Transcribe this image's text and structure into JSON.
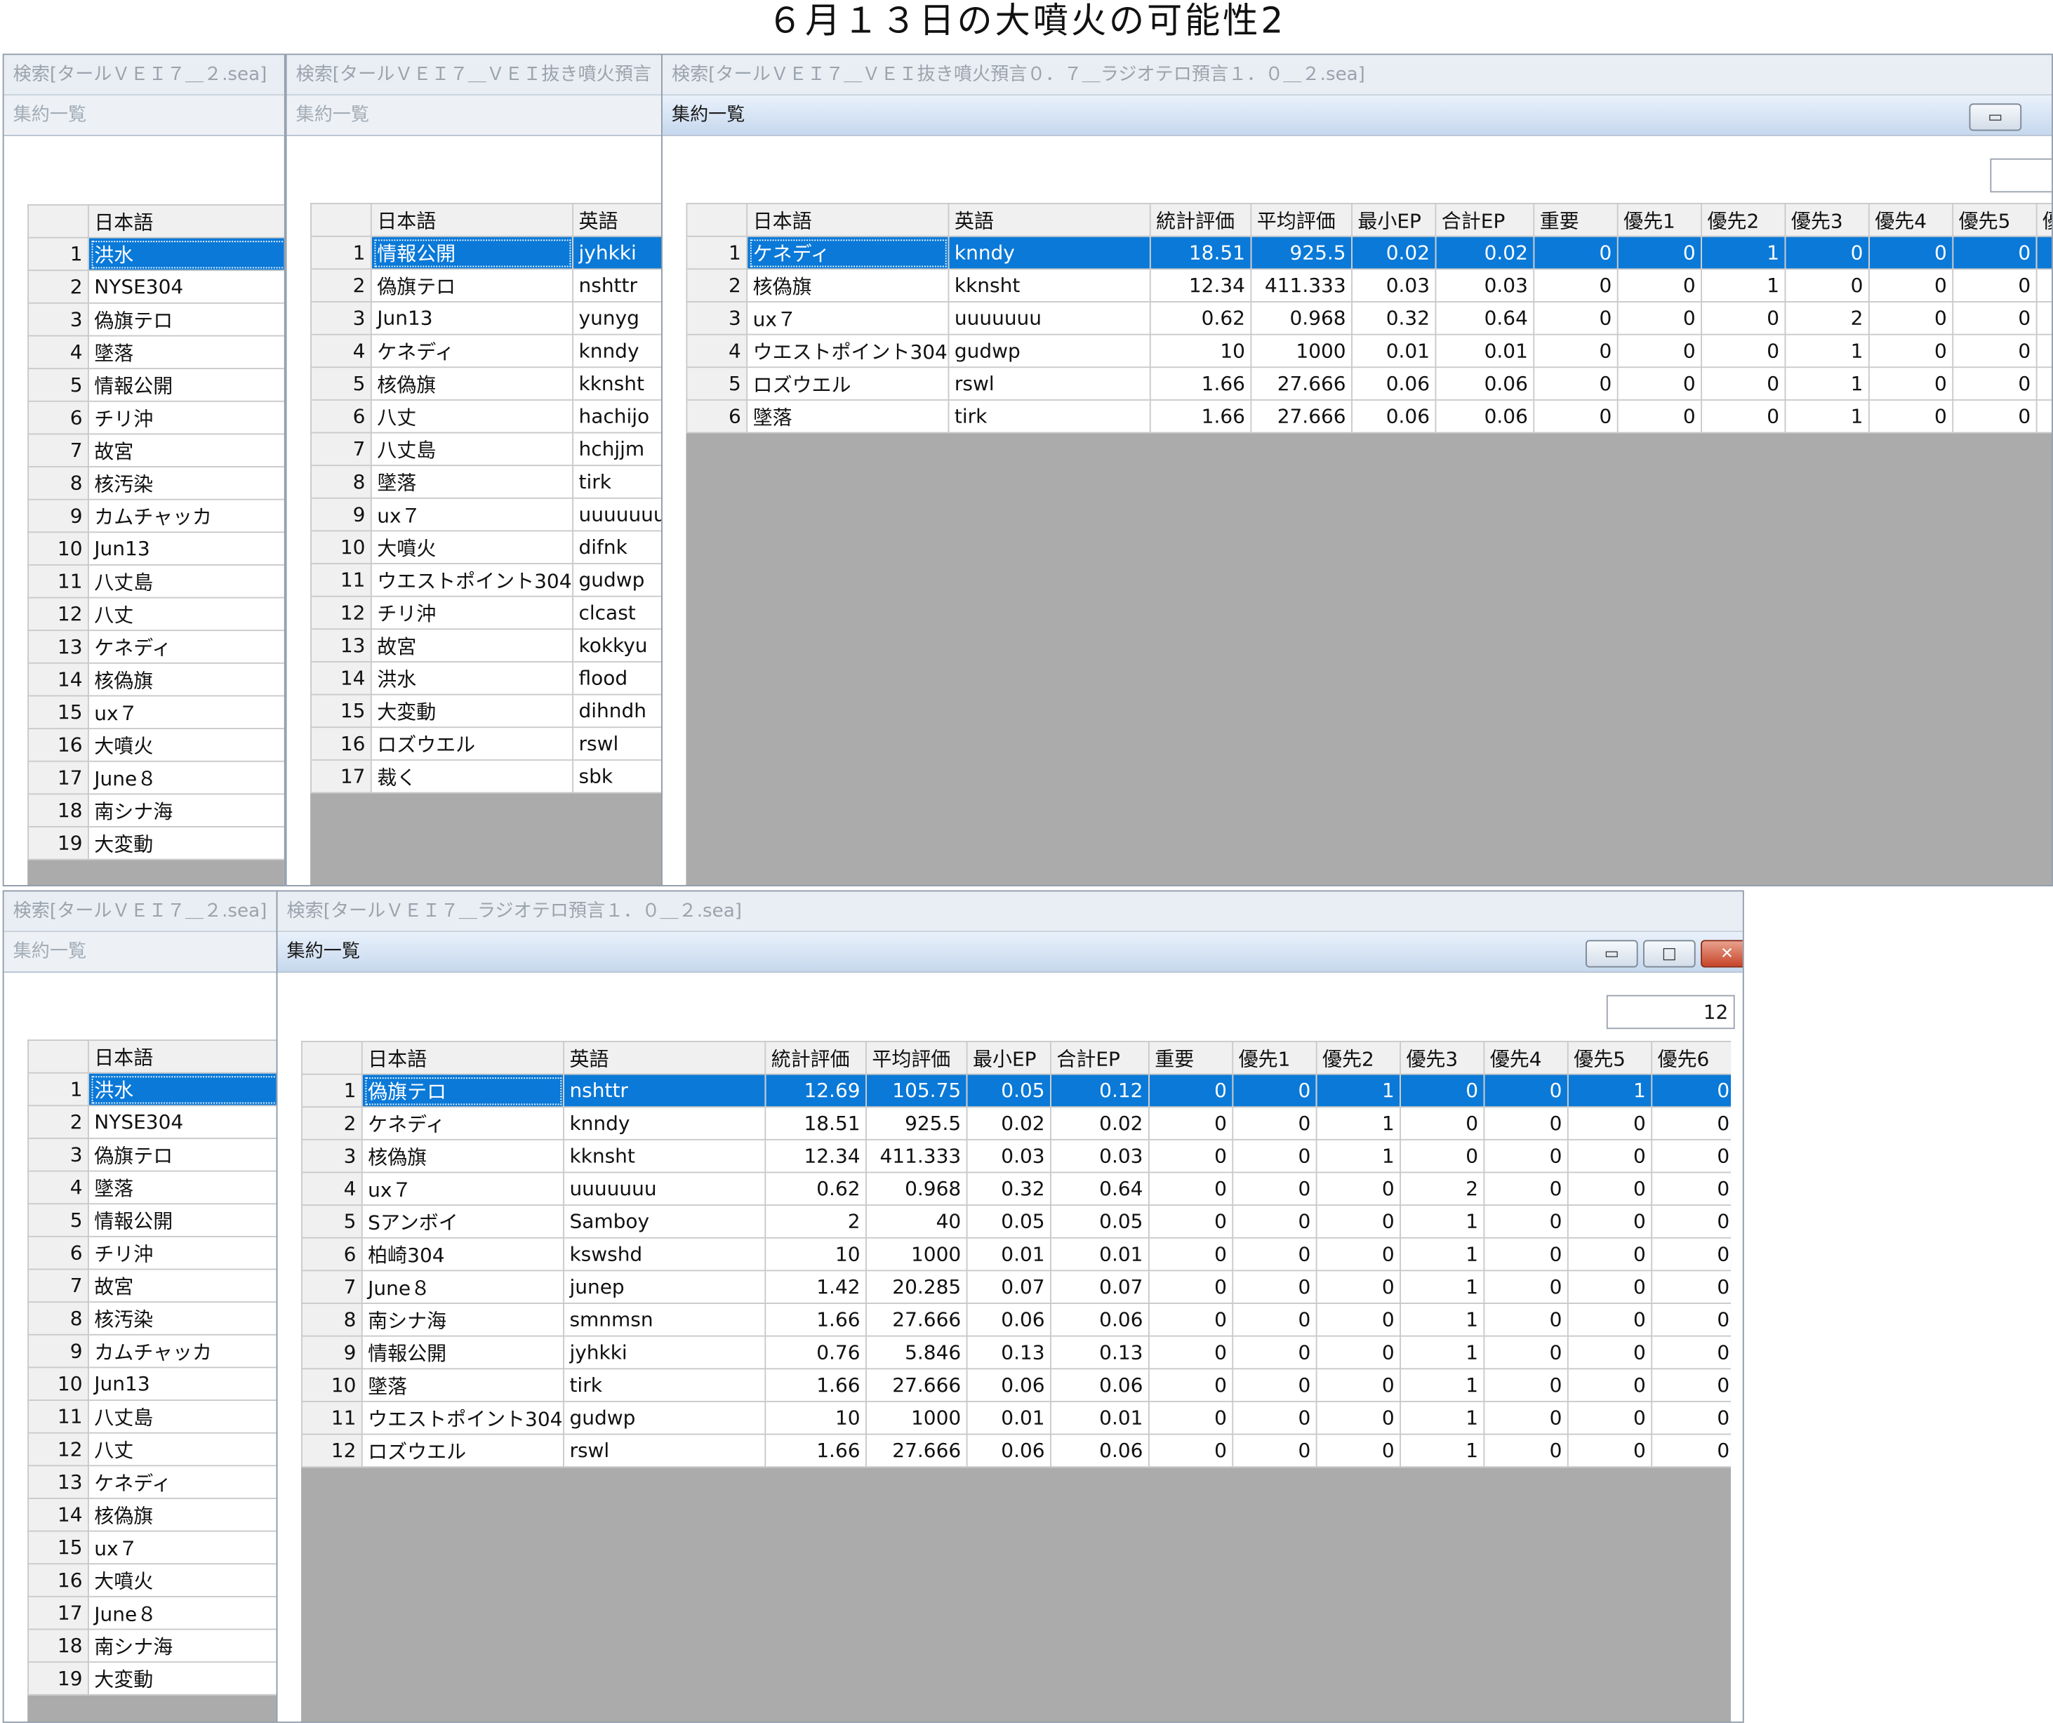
{
  "page_title": "６月１３日の大噴火の可能性2",
  "windows": {
    "w1": {
      "title": "検索[タールＶＥＩ７＿２.sea]",
      "sub": "集約一覧",
      "headers": [
        "",
        "日本語"
      ],
      "rows": [
        [
          "1",
          "洪水"
        ],
        [
          "2",
          "NYSE304"
        ],
        [
          "3",
          "偽旗テロ"
        ],
        [
          "4",
          "墜落"
        ],
        [
          "5",
          "情報公開"
        ],
        [
          "6",
          "チリ沖"
        ],
        [
          "7",
          "故宮"
        ],
        [
          "8",
          "核汚染"
        ],
        [
          "9",
          "カムチャッカ"
        ],
        [
          "10",
          "Jun13"
        ],
        [
          "11",
          "八丈島"
        ],
        [
          "12",
          "八丈"
        ],
        [
          "13",
          "ケネディ"
        ],
        [
          "14",
          "核偽旗"
        ],
        [
          "15",
          "ux７"
        ],
        [
          "16",
          "大噴火"
        ],
        [
          "17",
          "June８"
        ],
        [
          "18",
          "南シナ海"
        ],
        [
          "19",
          "大変動"
        ]
      ]
    },
    "w2": {
      "title": "検索[タールＶＥＩ７＿ＶＥＩ抜き噴火預言",
      "sub": "集約一覧",
      "headers": [
        "",
        "日本語",
        "英語"
      ],
      "rows": [
        [
          "1",
          "情報公開",
          "jyhkki"
        ],
        [
          "2",
          "偽旗テロ",
          "nshttr"
        ],
        [
          "3",
          "Jun13",
          "yunyg"
        ],
        [
          "4",
          "ケネディ",
          "knndy"
        ],
        [
          "5",
          "核偽旗",
          "kknsht"
        ],
        [
          "6",
          "八丈",
          "hachijo"
        ],
        [
          "7",
          "八丈島",
          "hchjjm"
        ],
        [
          "8",
          "墜落",
          "tirk"
        ],
        [
          "9",
          "ux７",
          "uuuuuuu"
        ],
        [
          "10",
          "大噴火",
          "difnk"
        ],
        [
          "11",
          "ウエストポイント304",
          "gudwp"
        ],
        [
          "12",
          "チリ沖",
          "clcast"
        ],
        [
          "13",
          "故宮",
          "kokkyu"
        ],
        [
          "14",
          "洪水",
          "flood"
        ],
        [
          "15",
          "大変動",
          "dihndh"
        ],
        [
          "16",
          "ロズウエル",
          "rswl"
        ],
        [
          "17",
          "裁く",
          "sbk"
        ]
      ]
    },
    "w3": {
      "title": "検索[タールＶＥＩ７＿ＶＥＩ抜き噴火預言０．７＿ラジオテロ預言１．０＿２.sea]",
      "sub": "集約一覧",
      "headers": [
        "",
        "日本語",
        "英語",
        "統計評価",
        "平均評価",
        "最小EP",
        "合計EP",
        "重要",
        "優先1",
        "優先2",
        "優先3",
        "優先4",
        "優先5",
        "優"
      ],
      "rows": [
        [
          "1",
          "ケネディ",
          "knndy",
          "18.51",
          "925.5",
          "0.02",
          "0.02",
          "0",
          "0",
          "1",
          "0",
          "0",
          "0",
          ""
        ],
        [
          "2",
          "核偽旗",
          "kknsht",
          "12.34",
          "411.333",
          "0.03",
          "0.03",
          "0",
          "0",
          "1",
          "0",
          "0",
          "0",
          ""
        ],
        [
          "3",
          "ux７",
          "uuuuuuu",
          "0.62",
          "0.968",
          "0.32",
          "0.64",
          "0",
          "0",
          "0",
          "2",
          "0",
          "0",
          ""
        ],
        [
          "4",
          "ウエストポイント304",
          "gudwp",
          "10",
          "1000",
          "0.01",
          "0.01",
          "0",
          "0",
          "0",
          "1",
          "0",
          "0",
          ""
        ],
        [
          "5",
          "ロズウエル",
          "rswl",
          "1.66",
          "27.666",
          "0.06",
          "0.06",
          "0",
          "0",
          "0",
          "1",
          "0",
          "0",
          ""
        ],
        [
          "6",
          "墜落",
          "tirk",
          "1.66",
          "27.666",
          "0.06",
          "0.06",
          "0",
          "0",
          "0",
          "1",
          "0",
          "0",
          ""
        ]
      ]
    },
    "w4": {
      "title": "検索[タールＶＥＩ７＿２.sea]",
      "sub": "集約一覧",
      "headers": [
        "",
        "日本語"
      ],
      "rows": [
        [
          "1",
          "洪水"
        ],
        [
          "2",
          "NYSE304"
        ],
        [
          "3",
          "偽旗テロ"
        ],
        [
          "4",
          "墜落"
        ],
        [
          "5",
          "情報公開"
        ],
        [
          "6",
          "チリ沖"
        ],
        [
          "7",
          "故宮"
        ],
        [
          "8",
          "核汚染"
        ],
        [
          "9",
          "カムチャッカ"
        ],
        [
          "10",
          "Jun13"
        ],
        [
          "11",
          "八丈島"
        ],
        [
          "12",
          "八丈"
        ],
        [
          "13",
          "ケネディ"
        ],
        [
          "14",
          "核偽旗"
        ],
        [
          "15",
          "ux７"
        ],
        [
          "16",
          "大噴火"
        ],
        [
          "17",
          "June８"
        ],
        [
          "18",
          "南シナ海"
        ],
        [
          "19",
          "大変動"
        ]
      ]
    },
    "w5": {
      "title": "検索[タールＶＥＩ７＿ラジオテロ預言１．０＿２.sea]",
      "sub": "集約一覧",
      "count": "12",
      "buttons": {
        "minimize": "▭",
        "maximize": "□",
        "close": "✕"
      },
      "headers": [
        "",
        "日本語",
        "英語",
        "統計評価",
        "平均評価",
        "最小EP",
        "合計EP",
        "重要",
        "優先1",
        "優先2",
        "優先3",
        "優先4",
        "優先5",
        "優先6"
      ],
      "rows": [
        [
          "1",
          "偽旗テロ",
          "nshttr",
          "12.69",
          "105.75",
          "0.05",
          "0.12",
          "0",
          "0",
          "1",
          "0",
          "0",
          "1",
          "0"
        ],
        [
          "2",
          "ケネディ",
          "knndy",
          "18.51",
          "925.5",
          "0.02",
          "0.02",
          "0",
          "0",
          "1",
          "0",
          "0",
          "0",
          "0"
        ],
        [
          "3",
          "核偽旗",
          "kknsht",
          "12.34",
          "411.333",
          "0.03",
          "0.03",
          "0",
          "0",
          "1",
          "0",
          "0",
          "0",
          "0"
        ],
        [
          "4",
          "ux７",
          "uuuuuuu",
          "0.62",
          "0.968",
          "0.32",
          "0.64",
          "0",
          "0",
          "0",
          "2",
          "0",
          "0",
          "0"
        ],
        [
          "5",
          "Sアンボイ",
          "Samboy",
          "2",
          "40",
          "0.05",
          "0.05",
          "0",
          "0",
          "0",
          "1",
          "0",
          "0",
          "0"
        ],
        [
          "6",
          "柏崎304",
          "kswshd",
          "10",
          "1000",
          "0.01",
          "0.01",
          "0",
          "0",
          "0",
          "1",
          "0",
          "0",
          "0"
        ],
        [
          "7",
          "June８",
          "junep",
          "1.42",
          "20.285",
          "0.07",
          "0.07",
          "0",
          "0",
          "0",
          "1",
          "0",
          "0",
          "0"
        ],
        [
          "8",
          "南シナ海",
          "smnmsn",
          "1.66",
          "27.666",
          "0.06",
          "0.06",
          "0",
          "0",
          "0",
          "1",
          "0",
          "0",
          "0"
        ],
        [
          "9",
          "情報公開",
          "jyhkki",
          "0.76",
          "5.846",
          "0.13",
          "0.13",
          "0",
          "0",
          "0",
          "1",
          "0",
          "0",
          "0"
        ],
        [
          "10",
          "墜落",
          "tirk",
          "1.66",
          "27.666",
          "0.06",
          "0.06",
          "0",
          "0",
          "0",
          "1",
          "0",
          "0",
          "0"
        ],
        [
          "11",
          "ウエストポイント304",
          "gudwp",
          "10",
          "1000",
          "0.01",
          "0.01",
          "0",
          "0",
          "0",
          "1",
          "0",
          "0",
          "0"
        ],
        [
          "12",
          "ロズウエル",
          "rswl",
          "1.66",
          "27.666",
          "0.06",
          "0.06",
          "0",
          "0",
          "0",
          "1",
          "0",
          "0",
          "0"
        ]
      ]
    }
  }
}
